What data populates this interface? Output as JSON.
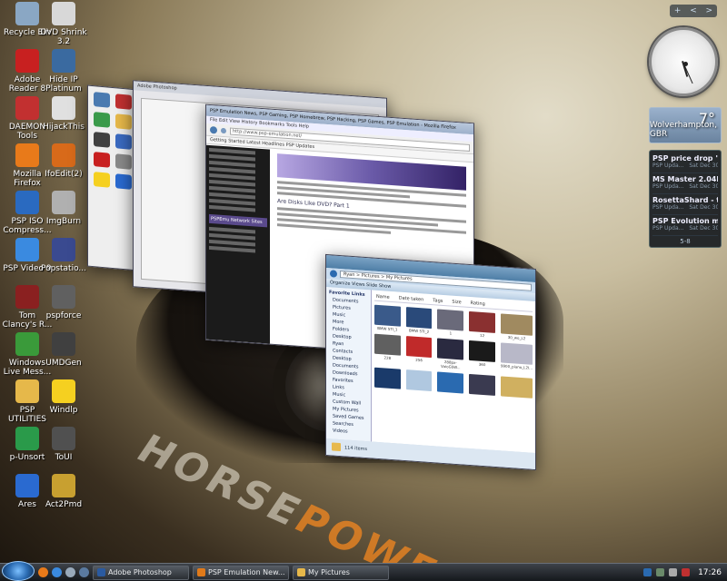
{
  "desktop": {
    "icons": [
      {
        "label": "Recycle Bin",
        "icon": "recycle-bin-icon",
        "color": "#8aa7c4"
      },
      {
        "label": "DVD Shrink 3.2",
        "icon": "dvd-shrink-icon",
        "color": "#d8d8d8"
      },
      {
        "label": "Adobe Reader 8",
        "icon": "pdf-icon",
        "color": "#c82020"
      },
      {
        "label": "Hide IP Platinum",
        "icon": "hide-ip-icon",
        "color": "#3a6aa0"
      },
      {
        "label": "DAEMON Tools",
        "icon": "daemon-tools-icon",
        "color": "#c23030"
      },
      {
        "label": "HijackThis",
        "icon": "hijackthis-icon",
        "color": "#e0e0e0"
      },
      {
        "label": "Mozilla Firefox",
        "icon": "firefox-icon",
        "color": "#e87a1a"
      },
      {
        "label": "IfoEdit(2)",
        "icon": "ifoedit-icon",
        "color": "#d86a1a"
      },
      {
        "label": "PSP ISO Compress...",
        "icon": "psp-iso-icon",
        "color": "#2a6ac0"
      },
      {
        "label": "ImgBurn",
        "icon": "imgburn-icon",
        "color": "#b0b0b0"
      },
      {
        "label": "PSP Video 9",
        "icon": "psp-video-icon",
        "color": "#3a8ae0"
      },
      {
        "label": "Popstatio...",
        "icon": "popstation-icon",
        "color": "#3a4a90"
      },
      {
        "label": "Tom Clancy's R...",
        "icon": "game-icon",
        "color": "#8a2020"
      },
      {
        "label": "pspforce",
        "icon": "pspforce-icon",
        "color": "#606060"
      },
      {
        "label": "Windows Live Mess...",
        "icon": "messenger-icon",
        "color": "#3a9a3a"
      },
      {
        "label": "UMDGen",
        "icon": "umdgen-icon",
        "color": "#404040"
      },
      {
        "label": "PSP UTILITIES",
        "icon": "folder-icon",
        "color": "#e6b84a"
      },
      {
        "label": "Windlp",
        "icon": "smiley-icon",
        "color": "#f5d020"
      },
      {
        "label": "p-Unsort",
        "icon": "p-unsort-icon",
        "color": "#2a9a4a"
      },
      {
        "label": "ToUI",
        "icon": "toui-icon",
        "color": "#505050"
      },
      {
        "label": "Ares",
        "icon": "ares-icon",
        "color": "#2a6ad0"
      },
      {
        "label": "Act2Pmd",
        "icon": "act2pmd-icon",
        "color": "#c8a030"
      }
    ]
  },
  "windows": {
    "photoshop": {
      "title": "Adobe Photoshop"
    },
    "browser": {
      "title": "PSP Emulation News, PSP Gaming, PSP Homebrew, PSP Hacking, PSP Games, PSP Emulation - Mozilla Firefox",
      "menu": [
        "File",
        "Edit",
        "View",
        "History",
        "Bookmarks",
        "Tools",
        "Help"
      ],
      "url": "http://www.psp-emulation.net/",
      "bookmarks": "Getting Started   Latest Headlines   PSP Updates",
      "sidebar_section": "PSPEmu Network Sites",
      "article_title": "Are Disks Like DVD? Part 1"
    },
    "explorer": {
      "path": "Ryan > Pictures > My Pictures",
      "commands": "Organize   Views   Slide Show",
      "columns": [
        "Name",
        "Date taken",
        "Tags",
        "Size",
        "Rating"
      ],
      "nav_title": "Favorite Links",
      "nav_items": [
        "Documents",
        "Pictures",
        "Music",
        "More",
        "Folders",
        "Desktop",
        "Ryan",
        "Contacts",
        "Desktop",
        "Documents",
        "Downloads",
        "Favorites",
        "Links",
        "Music",
        "Custom Wall",
        "My Pictures",
        "Saved Games",
        "Searches",
        "Videos"
      ],
      "thumbs": [
        {
          "name": "BMW STI_1",
          "color": "#3a5a8a"
        },
        {
          "name": "BMW STI_2",
          "color": "#2a4a7a"
        },
        {
          "name": "1",
          "color": "#6a6a7a"
        },
        {
          "name": "12",
          "color": "#8a3030"
        },
        {
          "name": "30_wo_L2",
          "color": "#a08a60"
        },
        {
          "name": "228",
          "color": "#606060"
        },
        {
          "name": "256",
          "color": "#c02a2a"
        },
        {
          "name": "288px-VaioGSW...",
          "color": "#2a2a40"
        },
        {
          "name": "360",
          "color": "#1a1a1a"
        },
        {
          "name": "9900_piano_L2I...",
          "color": "#b8b8c8"
        },
        {
          "name": "",
          "color": "#1a3a6a"
        },
        {
          "name": "",
          "color": "#b0c8e0"
        },
        {
          "name": "",
          "color": "#2a6ab0"
        },
        {
          "name": "",
          "color": "#3a3a50"
        },
        {
          "name": "",
          "color": "#d0b060"
        }
      ],
      "status": "114 items"
    }
  },
  "sidebar": {
    "controls": [
      "+",
      "<",
      ">"
    ],
    "clock": {
      "hour": 5,
      "minute": 26
    },
    "weather": {
      "temperature": "7°",
      "city": "Wolverhampton, GBR"
    },
    "feeds": [
      {
        "title": "PSP price drop \"US o...",
        "source": "PSP Upda...",
        "date": "Sat Dec 30"
      },
      {
        "title": "MS Master 2.04b",
        "source": "PSP Upda...",
        "date": "Sat Dec 30"
      },
      {
        "title": "RosettaShard - the b...",
        "source": "PSP Upda...",
        "date": "Sat Dec 30"
      },
      {
        "title": "PSP Evolution mod b...",
        "source": "PSP Upda...",
        "date": "Sat Dec 30"
      }
    ],
    "pager": "5-8"
  },
  "taskbar": {
    "tasks": [
      {
        "label": "Adobe Photoshop",
        "icon_color": "#2a5aa0"
      },
      {
        "label": "PSP Emulation New...",
        "icon_color": "#e07a1a"
      },
      {
        "label": "My Pictures",
        "icon_color": "#e6b84a"
      }
    ],
    "time": "17:26"
  }
}
